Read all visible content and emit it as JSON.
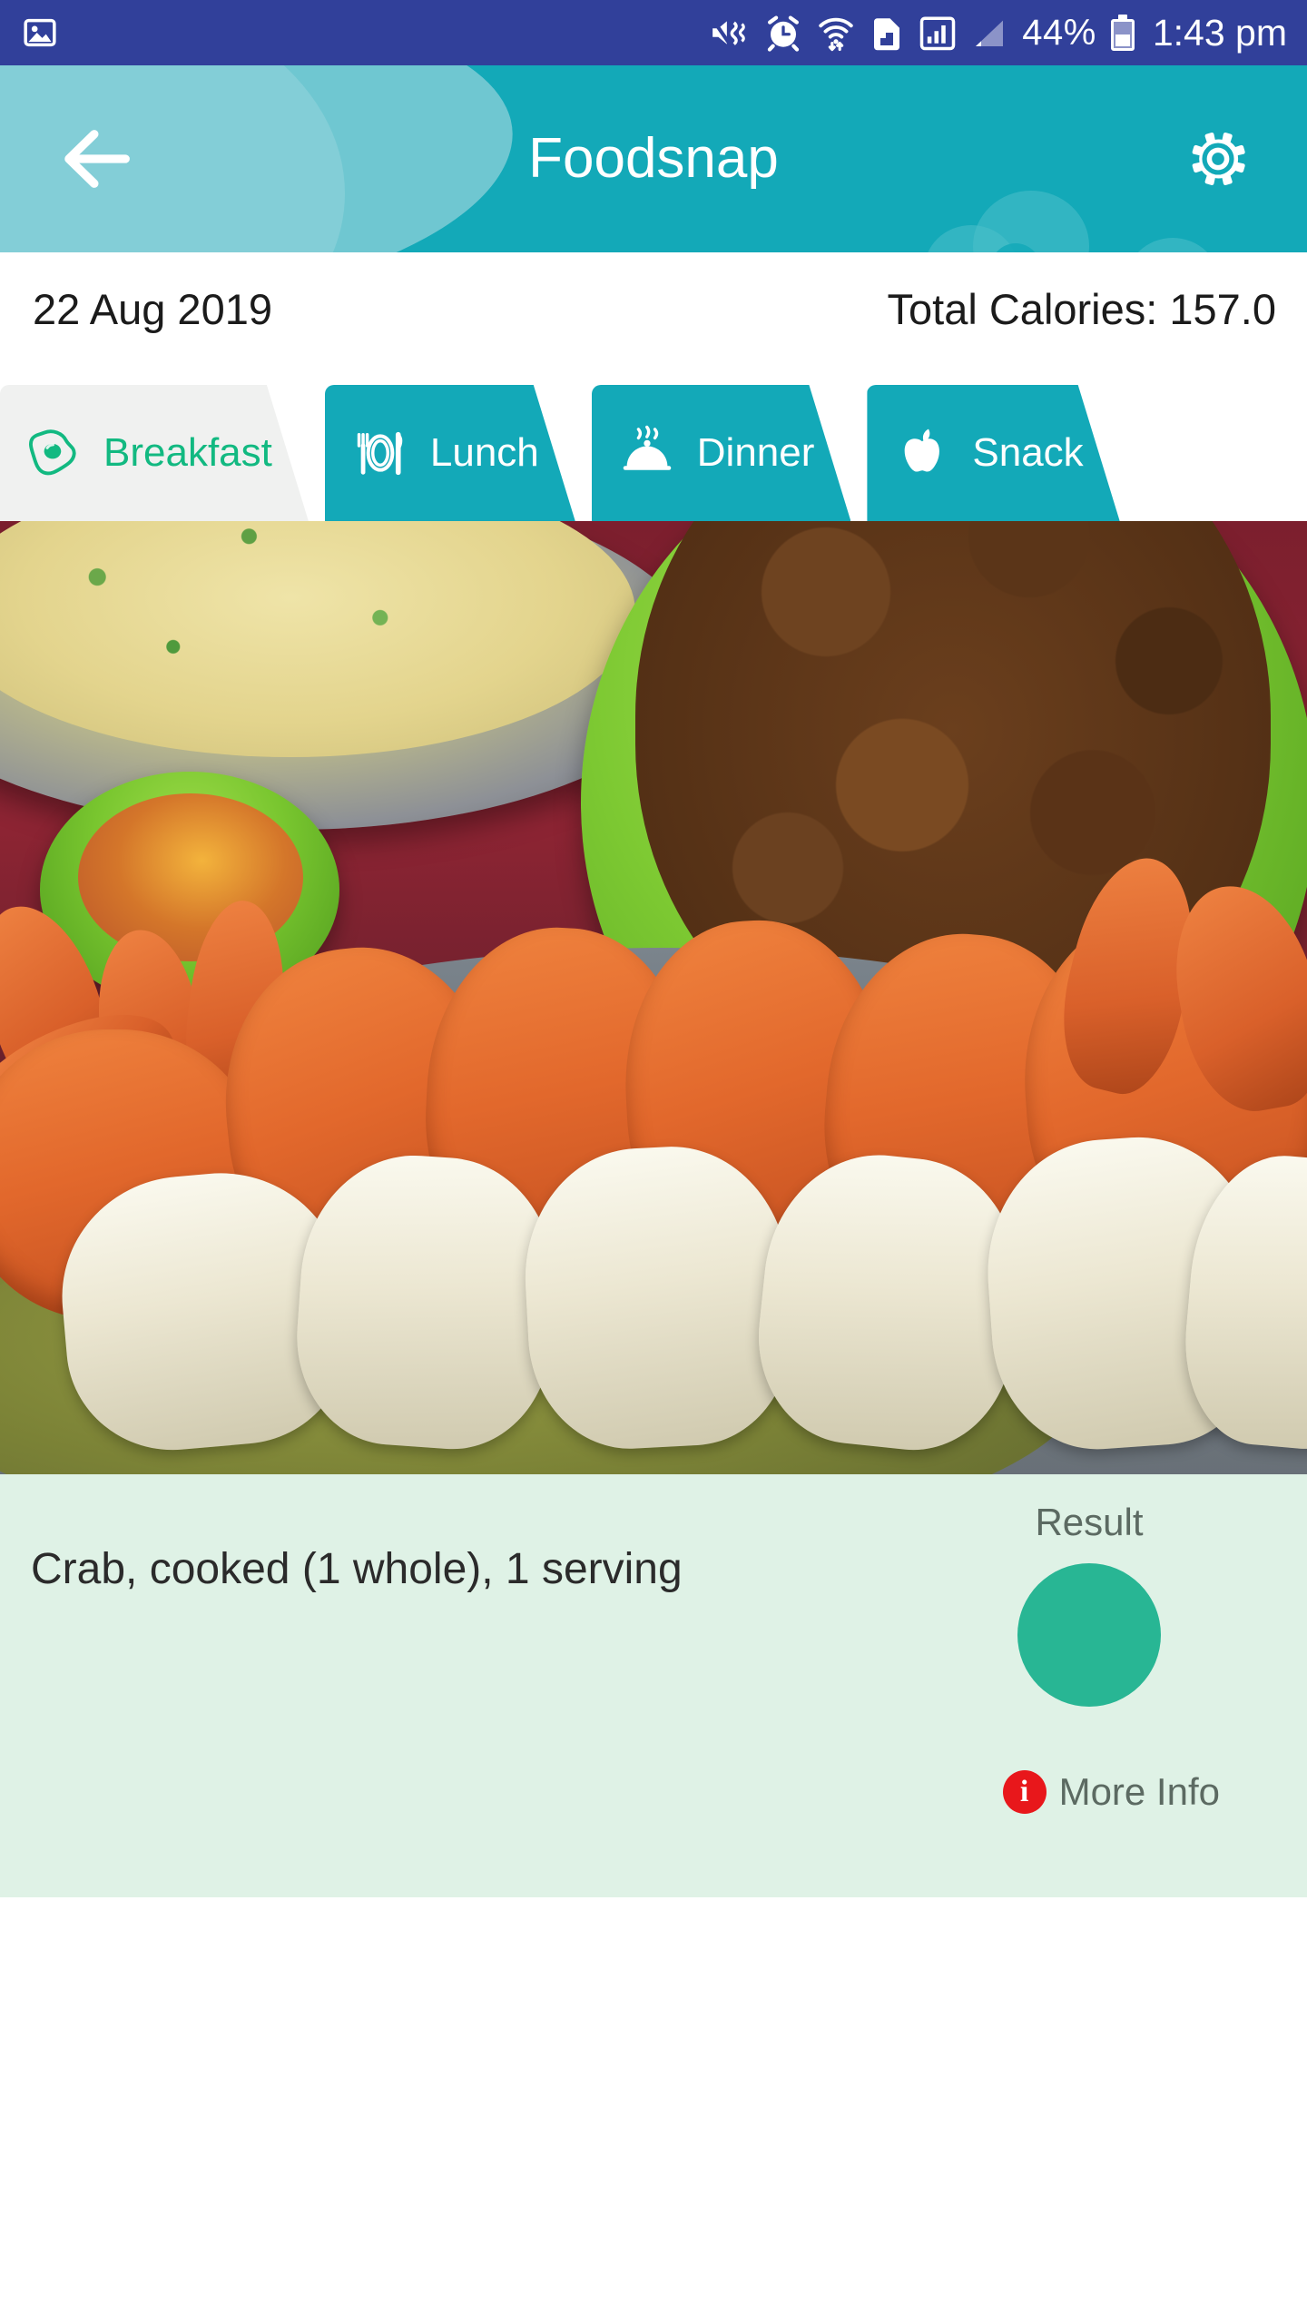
{
  "status_bar": {
    "background": "#31409a",
    "left_icons": [
      {
        "name": "image-notification-icon",
        "glyph": "image"
      }
    ],
    "right_icons": [
      {
        "name": "sound-off-vibrate-icon",
        "glyph": "mute-vibrate"
      },
      {
        "name": "alarm-clock-icon",
        "glyph": "alarm"
      },
      {
        "name": "wifi-transfer-icon",
        "glyph": "wifi-arrows"
      },
      {
        "name": "sim-card-icon",
        "glyph": "sim"
      },
      {
        "name": "signal-bars-icon",
        "glyph": "signal-boxed"
      },
      {
        "name": "signal-bars-secondary-icon",
        "glyph": "signal-triangle"
      }
    ],
    "battery_percent": "44%",
    "time": "1:43 pm"
  },
  "header": {
    "title": "Foodsnap",
    "background": "#13a9b8",
    "back_label": "Back",
    "settings_label": "Settings"
  },
  "info_row": {
    "date": "22 Aug 2019",
    "total_calories": "Total Calories: 157.0"
  },
  "tabs": {
    "active_index": 0,
    "active_bg": "#f0f1f0",
    "active_fg": "#12b981",
    "inactive_bg": "#13a9b8",
    "inactive_fg": "#ffffff",
    "items": [
      {
        "label": "Breakfast",
        "icon": "fried-egg-icon",
        "active": true
      },
      {
        "label": "Lunch",
        "icon": "plate-cutlery-icon",
        "active": false
      },
      {
        "label": "Dinner",
        "icon": "cloche-icon",
        "active": false
      },
      {
        "label": "Snack",
        "icon": "apple-icon",
        "active": false
      }
    ]
  },
  "photo": {
    "alt": "Plate of cooked orange crabs with white crab meat on a grey tray, beside a green bowl of fried chicken, a green bowl of orange sauce and a plate of fried rice on a dark red table"
  },
  "result": {
    "card_bg": "#dff2e6",
    "food_name": "Crab, cooked (1 whole), 1 serving",
    "result_label": "Result",
    "result_dot_color": "#28b694",
    "more_info_label": "More Info",
    "more_info_icon": "info-icon",
    "more_info_icon_color": "#e8171b"
  }
}
